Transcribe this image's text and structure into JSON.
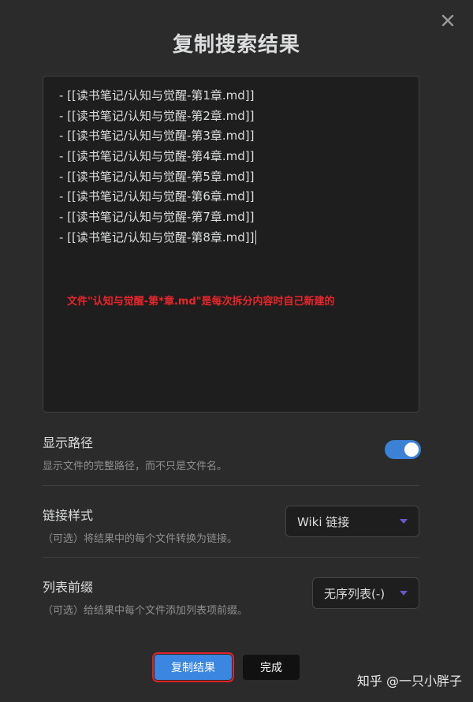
{
  "modal": {
    "title": "复制搜索结果",
    "close_icon": "close-icon"
  },
  "results": {
    "lines": [
      "- [[读书笔记/认知与觉醒-第1章.md]]",
      "- [[读书笔记/认知与觉醒-第2章.md]]",
      "- [[读书笔记/认知与觉醒-第3章.md]]",
      "- [[读书笔记/认知与觉醒-第4章.md]]",
      "- [[读书笔记/认知与觉醒-第5章.md]]",
      "- [[读书笔记/认知与觉醒-第6章.md]]",
      "- [[读书笔记/认知与觉醒-第7章.md]]",
      "- [[读书笔记/认知与觉醒-第8章.md]]"
    ],
    "annotation": "文件\"认知与觉醒-第*章.md\"是每次拆分内容时自己新建的",
    "annotation_color": "#e8262b"
  },
  "settings": {
    "show_path": {
      "name": "显示路径",
      "desc": "显示文件的完整路径，而不只是文件名。",
      "enabled": true
    },
    "link_style": {
      "name": "链接样式",
      "desc": "（可选）将结果中的每个文件转换为链接。",
      "selected": "Wiki 链接"
    },
    "list_prefix": {
      "name": "列表前缀",
      "desc": "（可选）给结果中每个文件添加列表项前缀。",
      "selected": "无序列表(-)"
    }
  },
  "buttons": {
    "copy_label": "复制结果",
    "done_label": "完成"
  },
  "watermark": "知乎 @一只小胖子",
  "colors": {
    "accent": "#3a86e0",
    "highlight_border": "#e0222a",
    "background": "#2b2b2b"
  }
}
